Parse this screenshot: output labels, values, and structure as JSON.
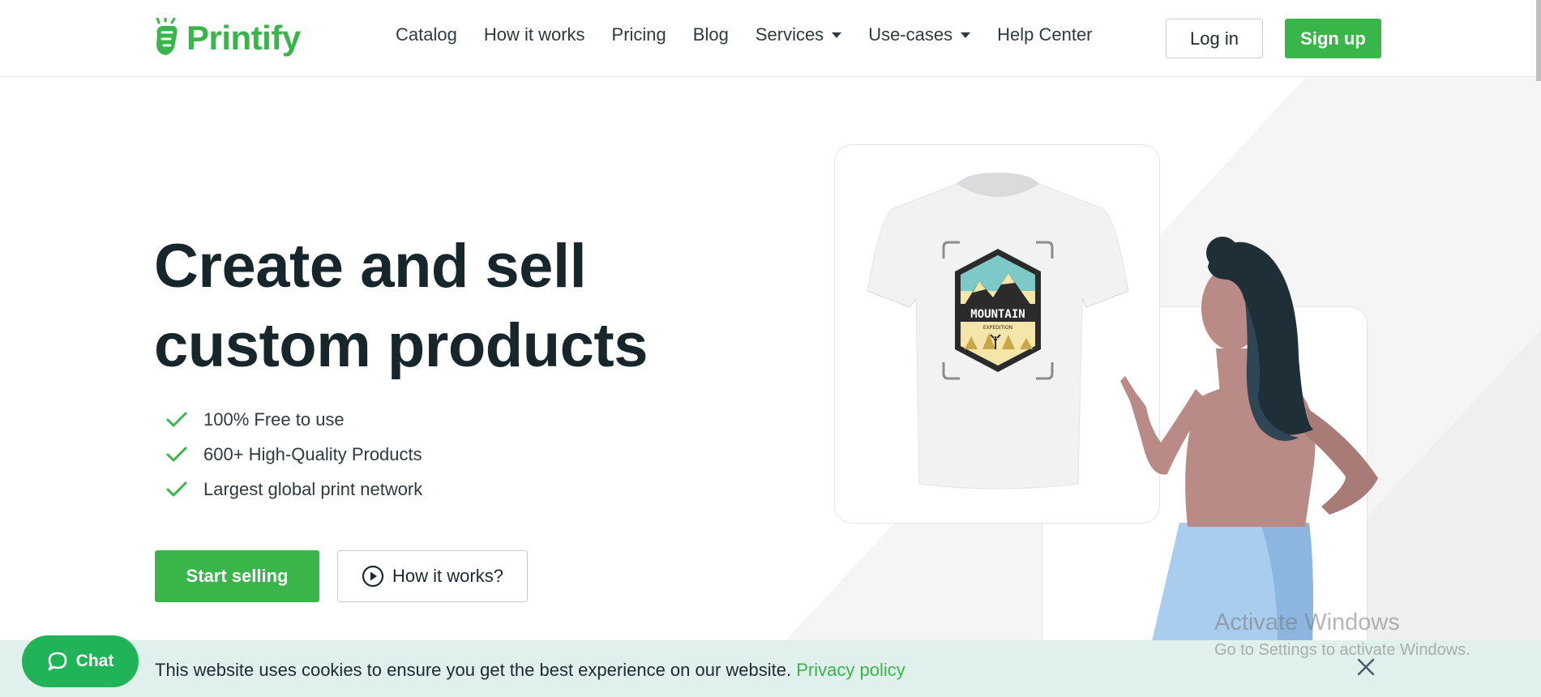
{
  "header": {
    "logo_text": "Printify",
    "nav": [
      {
        "label": "Catalog"
      },
      {
        "label": "How it works"
      },
      {
        "label": "Pricing"
      },
      {
        "label": "Blog"
      },
      {
        "label": "Services",
        "dropdown": true
      },
      {
        "label": "Use-cases",
        "dropdown": true
      },
      {
        "label": "Help Center"
      }
    ],
    "login_label": "Log in",
    "signup_label": "Sign up"
  },
  "hero": {
    "title_line1": "Create and sell",
    "title_line2": "custom products",
    "features": [
      "100% Free to use",
      "600+ High-Quality Products",
      "Largest global print network"
    ],
    "start_selling_label": "Start selling",
    "how_it_works_label": "How it works?",
    "shirt_badge_title": "MOUNTAIN",
    "shirt_badge_sub": "EXPEDITION"
  },
  "watermark": {
    "title": "Activate Windows",
    "subtitle": "Go to Settings to activate Windows."
  },
  "cookie": {
    "text": "This website uses cookies to ensure you get the best experience on our website.",
    "link_label": "Privacy policy"
  },
  "chat": {
    "label": "Chat"
  },
  "colors": {
    "brand_green": "#39b54a",
    "cookie_bg": "#e0f0ed",
    "text_dark": "#17262b"
  },
  "icons": [
    "printify-logo-icon",
    "check-icon",
    "play-circle-icon",
    "chat-bubble-icon",
    "close-icon",
    "chevron-down-icon"
  ]
}
